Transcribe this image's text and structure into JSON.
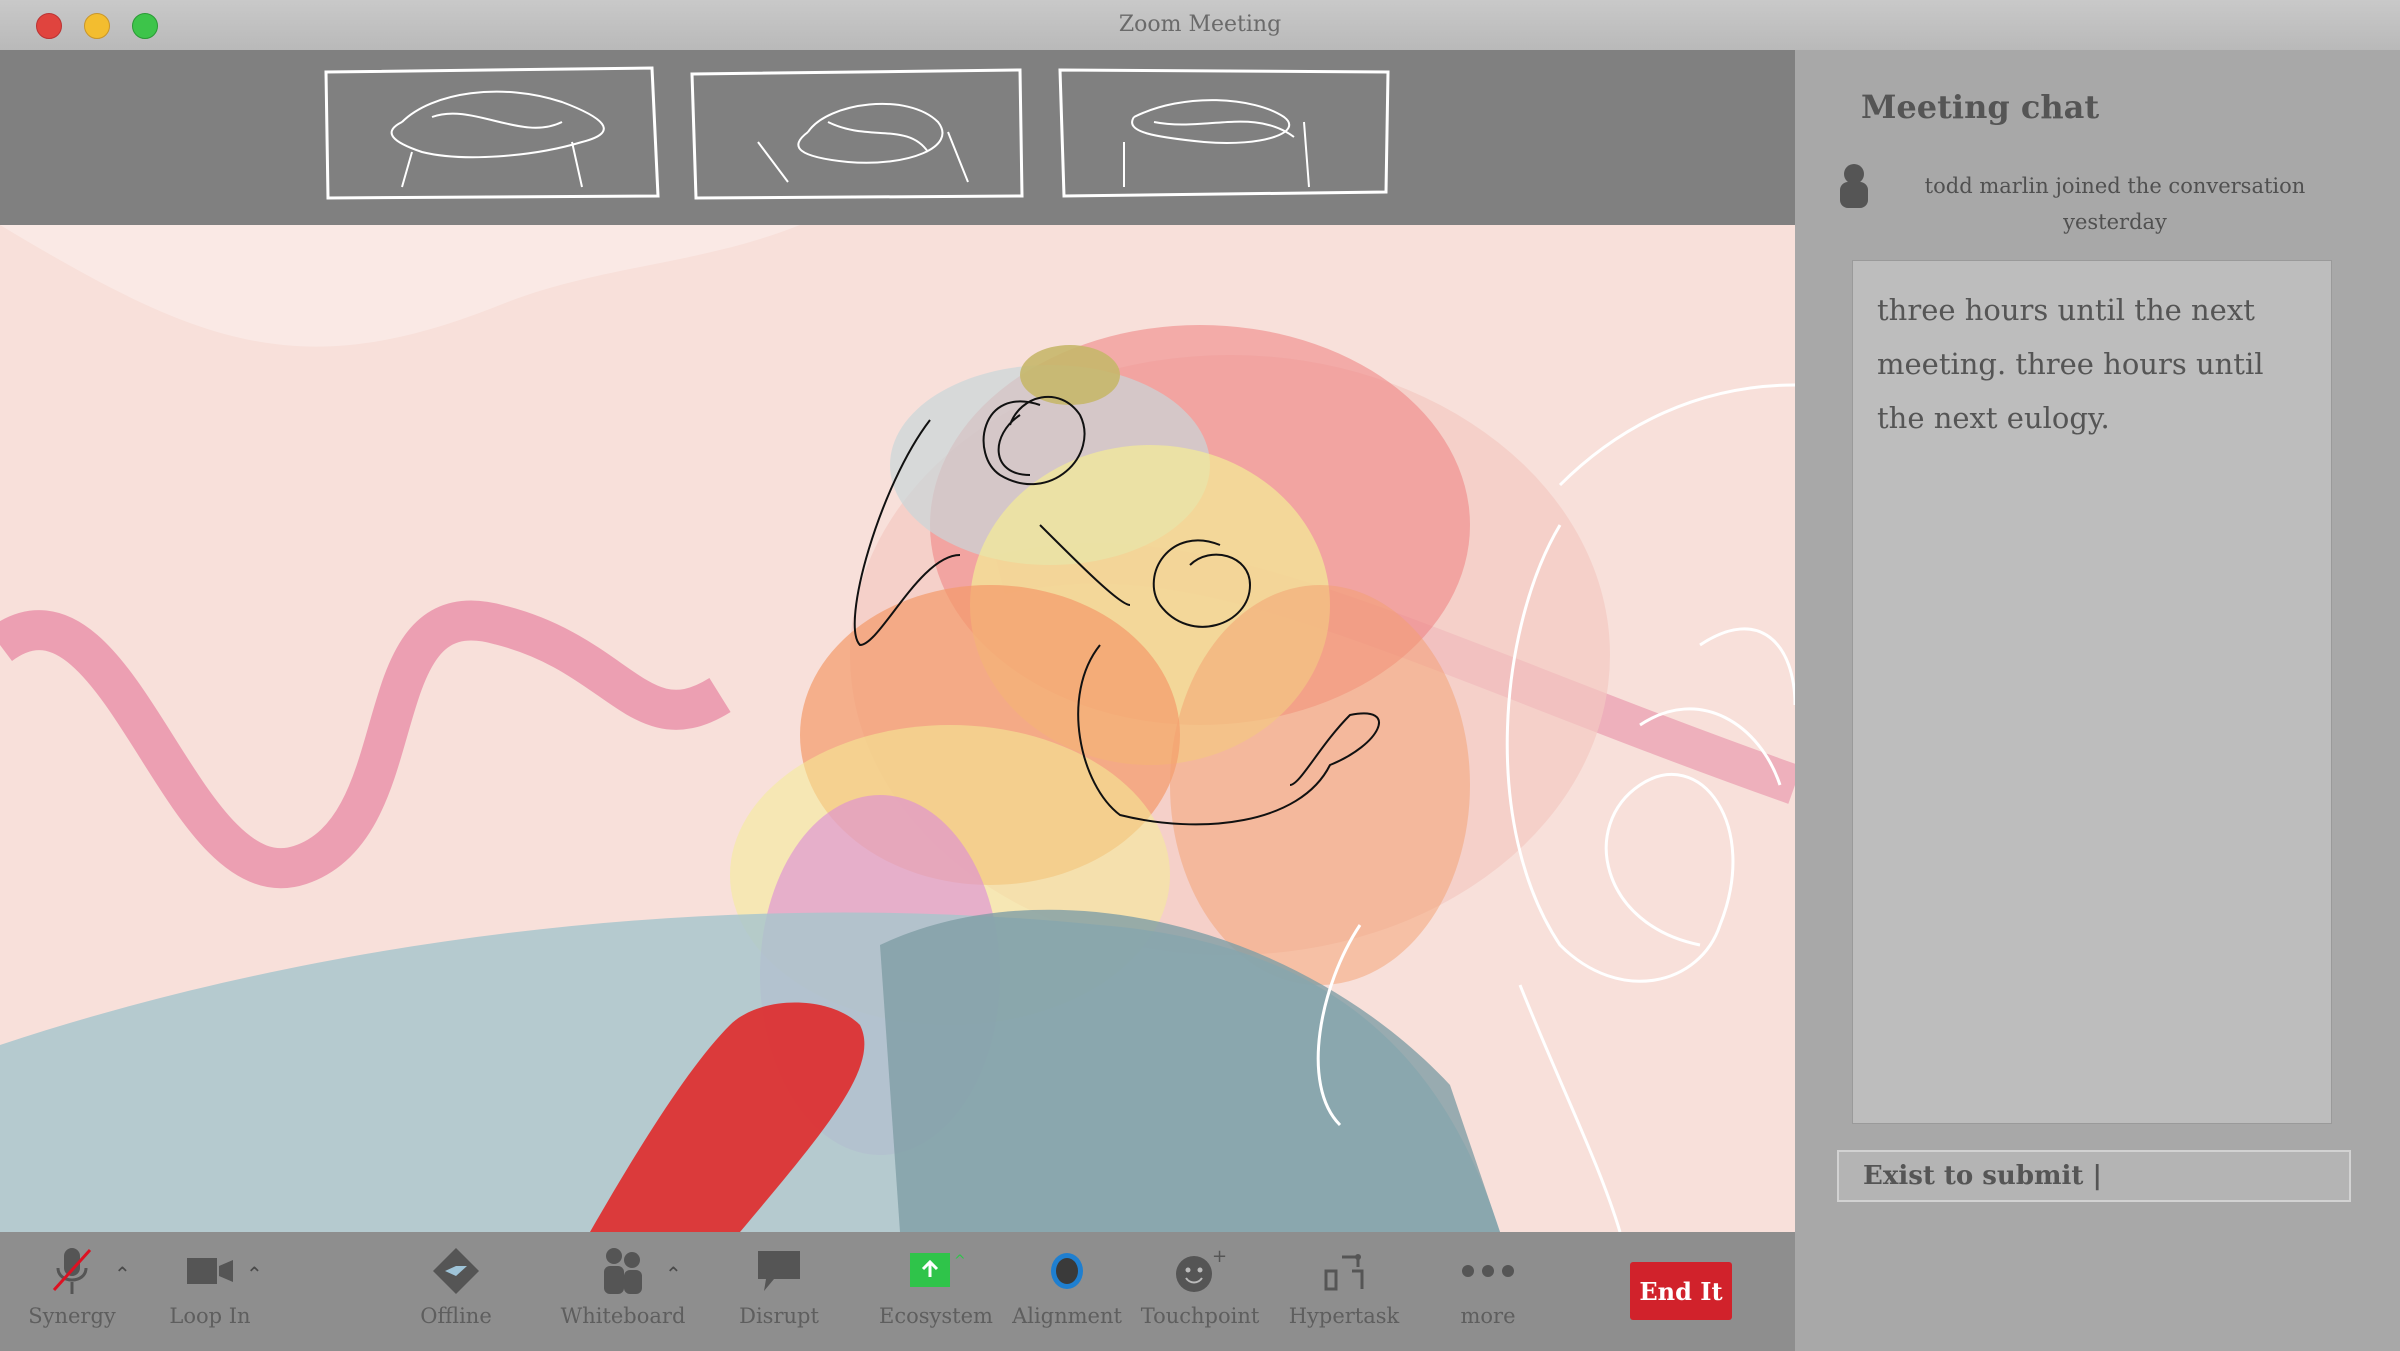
{
  "window": {
    "title": "Zoom Meeting"
  },
  "toolbar": {
    "items": [
      {
        "label": "Synergy",
        "icon": "microphone-muted-icon"
      },
      {
        "label": "Loop In",
        "icon": "video-camera-icon"
      },
      {
        "label": "Offline",
        "icon": "share-diamond-icon"
      },
      {
        "label": "Whiteboard",
        "icon": "participants-icon"
      },
      {
        "label": "Disrupt",
        "icon": "chat-bubble-icon"
      },
      {
        "label": "Ecosystem",
        "icon": "share-screen-icon"
      },
      {
        "label": "Alignment",
        "icon": "record-icon"
      },
      {
        "label": "Touchpoint",
        "icon": "reactions-icon"
      },
      {
        "label": "Hypertask",
        "icon": "apps-icon"
      },
      {
        "label": "more",
        "icon": "more-dots-icon"
      }
    ],
    "end_label": "End It"
  },
  "chat": {
    "title": "Meeting chat",
    "event": "todd marlin  joined the conversation",
    "event_time": "yesterday",
    "message": "three hours until the next meeting. three hours until the next eulogy.",
    "input_value": "Exist to submit |"
  },
  "colors": {
    "end_button": "#d1222b",
    "close": "#e0443e",
    "minimize": "#f3bd2f",
    "maximize": "#3dc44a",
    "ecosystem_icon": "#2fc44a",
    "alignment_icon": "#1f7fd0"
  }
}
